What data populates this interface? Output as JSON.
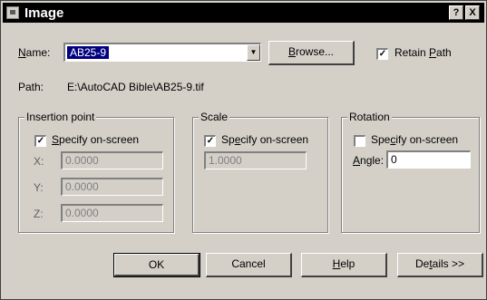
{
  "window": {
    "title": "Image",
    "help_glyph": "?",
    "close_glyph": "X",
    "icon": "image-app-icon"
  },
  "name_row": {
    "label": "Name:",
    "value": "AB25-9",
    "dropdown_glyph": "▼",
    "browse_label": "Browse...",
    "retain_path_label": "Retain Path",
    "retain_path_checked": true
  },
  "path_row": {
    "label": "Path:",
    "value": "E:\\AutoCAD Bible\\AB25-9.tif"
  },
  "insertion": {
    "title": "Insertion point",
    "specify_label": "Specify on-screen",
    "specify_checked": true,
    "x_label": "X:",
    "x_value": "0.0000",
    "y_label": "Y:",
    "y_value": "0.0000",
    "z_label": "Z:",
    "z_value": "0.0000"
  },
  "scale": {
    "title": "Scale",
    "specify_label": "Specify on-screen",
    "specify_checked": true,
    "value": "1.0000"
  },
  "rotation": {
    "title": "Rotation",
    "specify_label": "Specify on-screen",
    "specify_checked": false,
    "angle_label": "Angle:",
    "angle_value": "0"
  },
  "buttons": {
    "ok": "OK",
    "cancel": "Cancel",
    "help": "Help",
    "details": "Details >>"
  },
  "check_glyph": "✓"
}
